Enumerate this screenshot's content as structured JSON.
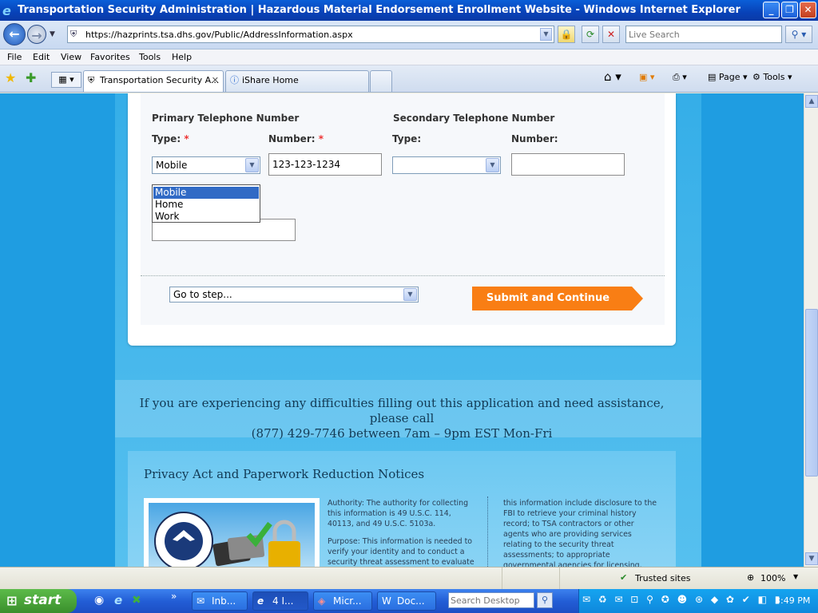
{
  "window": {
    "title": "Transportation Security Administration | Hazardous Material Endorsement Enrollment Website - Windows Internet Explorer",
    "minimize": "_",
    "maximize": "❐",
    "close": "✕"
  },
  "address_bar": {
    "url": "https://hazprints.tsa.dhs.gov/Public/AddressInformation.aspx",
    "search_placeholder": "Live Search"
  },
  "menu": [
    "File",
    "Edit",
    "View",
    "Favorites",
    "Tools",
    "Help"
  ],
  "tabs": [
    {
      "label": "Transportation Security A..."
    },
    {
      "label": "iShare Home"
    }
  ],
  "toolbar_right": {
    "page": "Page",
    "tools": "Tools"
  },
  "form": {
    "primary_heading": "Primary Telephone Number",
    "secondary_heading": "Secondary Telephone Number",
    "type_label": "Type:",
    "number_label": "Number:",
    "required_mark": "*",
    "primary_type_value": "Mobile",
    "primary_number_value": "123-123-1234",
    "secondary_type_value": "",
    "secondary_number_value": "",
    "type_options": [
      "Mobile",
      "Home",
      "Work"
    ],
    "go_to_step": "Go to step...",
    "submit_label": "Submit and Continue"
  },
  "help_text_line1": "If you are experiencing any difficulties filling out this application and need assistance, please call",
  "help_text_line2": "(877) 429-7746 between 7am – 9pm EST Mon-Fri",
  "privacy": {
    "title": "Privacy Act and Paperwork Reduction Notices",
    "authority": "Authority: The authority for collecting this information is 49 U.S.C. 114, 40113, and 49 U.S.C. 5103a.",
    "purpose": "Purpose: This information is needed to verify your identity and to conduct a security threat assessment to evaluate",
    "col2": "this information include disclosure to the FBI to retrieve your criminal history record; to TSA contractors or other agents who are providing services relating to the security threat assessments; to appropriate governmental agencies for licensing,"
  },
  "status_bar": {
    "zone": "Trusted sites",
    "zoom": "100%"
  },
  "taskbar": {
    "start": "start",
    "tasks": [
      "Inb...",
      "4 I...",
      "Micr...",
      "Doc..."
    ],
    "search_placeholder": "Search Desktop",
    "clock": "3:49 PM"
  },
  "colors": {
    "accent_orange": "#f97e14",
    "page_blue": "#1f9de1",
    "selected_option": "#316ac5"
  }
}
